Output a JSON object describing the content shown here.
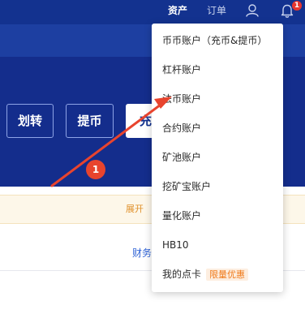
{
  "topnav": {
    "assets_label": "资产",
    "orders_label": "订单",
    "notification_count": "1",
    "user_icon": "user-icon",
    "bell_icon": "bell-icon"
  },
  "actions": {
    "transfer_label": "划转",
    "withdraw_label": "提币",
    "deposit_label": "充币"
  },
  "notice": {
    "expand_label": "展开"
  },
  "finance_link": "财务",
  "dropdown": {
    "items": [
      {
        "label": "币币账户（充币&提币）"
      },
      {
        "label": "杠杆账户"
      },
      {
        "label": "法币账户"
      },
      {
        "label": "合约账户"
      },
      {
        "label": "矿池账户"
      },
      {
        "label": "挖矿宝账户"
      },
      {
        "label": "量化账户"
      },
      {
        "label": "HB10"
      },
      {
        "label": "我的点卡",
        "tag": "限量优惠"
      }
    ]
  },
  "annotation": {
    "step_number": "1",
    "arrow_color": "#e8442e"
  },
  "colors": {
    "topbar": "#13328f",
    "hero": "#142d8c",
    "accent_orange": "#f07a1a",
    "link_blue": "#2f63d6"
  }
}
